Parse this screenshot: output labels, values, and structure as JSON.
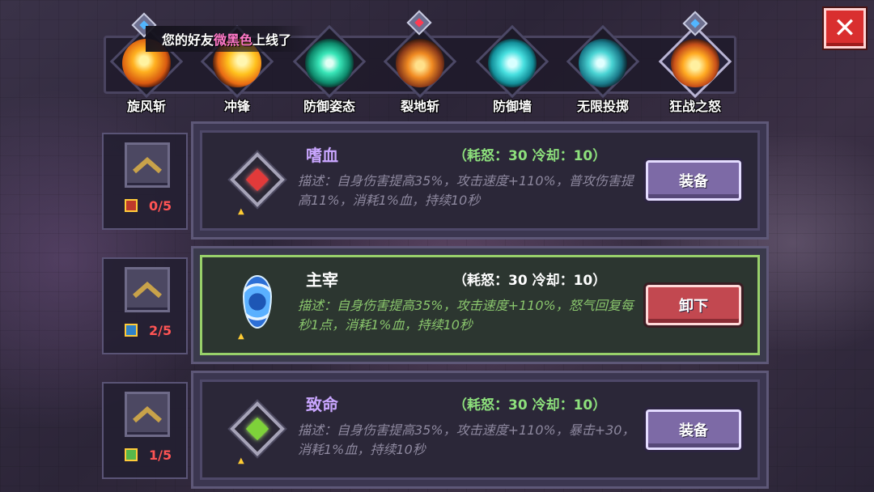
{
  "notice": {
    "prefix": "您的好友",
    "friend": "微黑色",
    "suffix": "上线了"
  },
  "close_label": "✕",
  "skills": [
    {
      "label": "旋风斩",
      "icon": "whirlwind-icon",
      "color": "#f0a020"
    },
    {
      "label": "冲锋",
      "icon": "charge-icon",
      "color": "#f4a41c"
    },
    {
      "label": "防御姿态",
      "icon": "defense-stance-icon",
      "color": "#1ec9a2"
    },
    {
      "label": "裂地斩",
      "icon": "ground-slash-icon",
      "color": "#e07a22"
    },
    {
      "label": "防御墙",
      "icon": "defense-wall-icon",
      "color": "#2fd6d0"
    },
    {
      "label": "无限投掷",
      "icon": "infinite-throw-icon",
      "color": "#33c8c8"
    },
    {
      "label": "狂战之怒",
      "icon": "berserker-rage-icon",
      "color": "#f09a20"
    }
  ],
  "rows": [
    {
      "name": "嗜血",
      "cost": "（耗怒：30  冷却：10）",
      "desc": "描述：自身伤害提高35%，攻击速度+110%，普攻伤害提高11%，消耗1%血，持续10秒",
      "level": "0/5",
      "button": "装备",
      "rune_color": "#e23a3a",
      "active": false
    },
    {
      "name": "主宰",
      "cost": "（耗怒：30  冷却：10）",
      "desc": "描述：自身伤害提高35%，攻击速度+110%，怒气回复每秒1点，消耗1%血，持续10秒",
      "level": "2/5",
      "button": "卸下",
      "rune_color": "#3a8cff",
      "active": true
    },
    {
      "name": "致命",
      "cost": "（耗怒：30  冷却：10）",
      "desc": "描述：自身伤害提高35%，攻击速度+110%，暴击+30，消耗1%血，持续10秒",
      "level": "1/5",
      "button": "装备",
      "rune_color": "#7ed23a",
      "active": false
    }
  ]
}
